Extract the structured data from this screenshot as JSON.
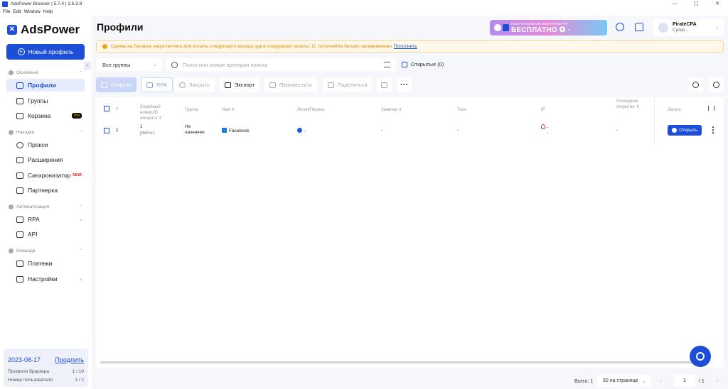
{
  "window": {
    "title": "AdsPower Browser | 5.7.4 | 2.6.3.8",
    "controls": [
      "—",
      "▢",
      "✕"
    ]
  },
  "menu": [
    "File",
    "Edit",
    "Window",
    "Help"
  ],
  "brand": "AdsPower",
  "new_profile_label": "Новый профиль",
  "sidebar": {
    "sections": [
      {
        "label": "Основные"
      },
      {
        "label": "Находки"
      },
      {
        "label": "Автоматизация"
      },
      {
        "label": "Команда"
      }
    ],
    "items": [
      {
        "label": "Профили"
      },
      {
        "label": "Группы"
      },
      {
        "label": "Корзина",
        "badge": "Pro"
      },
      {
        "label": "Прокси"
      },
      {
        "label": "Расширения"
      },
      {
        "label": "Синхронизатор",
        "badge": "NEW!"
      },
      {
        "label": "Партнерка"
      },
      {
        "label": "RPA"
      },
      {
        "label": "API"
      },
      {
        "label": "Платежи"
      },
      {
        "label": "Настройки"
      }
    ]
  },
  "plan": {
    "date": "2023-08-17",
    "renew": "Продлить",
    "rows": [
      {
        "label": "Профили браузера",
        "value": "1 / 10"
      },
      {
        "label": "Номер пользователя",
        "value": "1 / 2"
      }
    ]
  },
  "header": {
    "title": "Профили",
    "promo": {
      "top": "ПОЛУЧИ КОМБАЙН АККАУНТОВ FPF",
      "main": "БЕСПЛАТНО ✪ ·"
    },
    "user": {
      "name": "PirateCPA",
      "role": "Супер..."
    }
  },
  "notice": {
    "text": "Суммы на балансе недостаточно для оплаты следующего месяца (дата следующей оплаты: 1), пополняйте баланс своевременно",
    "link": "Пополнить"
  },
  "filters": {
    "group": "Все группы",
    "search_placeholder": "Поиск или новые критерии поиска",
    "opened_label": "Открытые (0)"
  },
  "toolbar": {
    "open": "Открыть",
    "rpa": "RPA",
    "close": "Закрыть",
    "export": "Экспорт",
    "move": "Переместить",
    "share": "Поделиться"
  },
  "table": {
    "headers": {
      "num": "#",
      "serial": "Серийный номер/ID аккаунта",
      "group": "Группа",
      "name": "Имя",
      "login": "Логин/Пароль",
      "notes": "Заметки",
      "tags": "Теги",
      "ip": "IP",
      "last_open": "Последнее открытие",
      "launch": "Запуск"
    },
    "rows": [
      {
        "num": "1",
        "serial_num": "1",
        "account_id": "j86ihox",
        "group": "Не назначен",
        "name": "Facebook",
        "login": "-",
        "notes": "-",
        "tags": "-",
        "ip": "-",
        "ip2": "-",
        "last_open": "-",
        "launch": "Открыть"
      }
    ]
  },
  "footer": {
    "total": "Всего: 1",
    "per_page": "50 на странице",
    "page": "1",
    "pages": "/ 1"
  },
  "colors": {
    "accent": "#1c4ed8",
    "warning": "#d98a00"
  }
}
